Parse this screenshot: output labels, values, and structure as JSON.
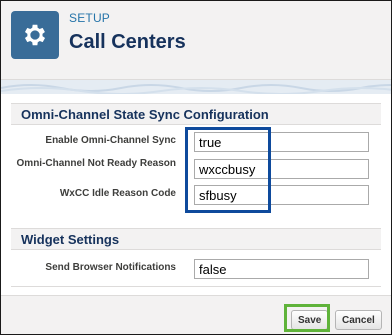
{
  "header": {
    "breadcrumb": "SETUP",
    "title": "Call Centers",
    "icon": "gear-icon",
    "icon_bg": "#396c98"
  },
  "sections": {
    "omni": {
      "title": "Omni-Channel State Sync Configuration",
      "fields": [
        {
          "label": "Enable Omni-Channel Sync",
          "value": "true"
        },
        {
          "label": "Omni-Channel Not Ready Reason",
          "value": "wxccbusy"
        },
        {
          "label": "WxCC Idle Reason Code",
          "value": "sfbusy"
        }
      ]
    },
    "widget": {
      "title": "Widget Settings",
      "fields": [
        {
          "label": "Send Browser Notifications",
          "value": "false"
        }
      ]
    }
  },
  "footer": {
    "save_label": "Save",
    "cancel_label": "Cancel"
  },
  "colors": {
    "highlight_blue": "#0e4a9c",
    "highlight_green": "#5fb33a"
  }
}
